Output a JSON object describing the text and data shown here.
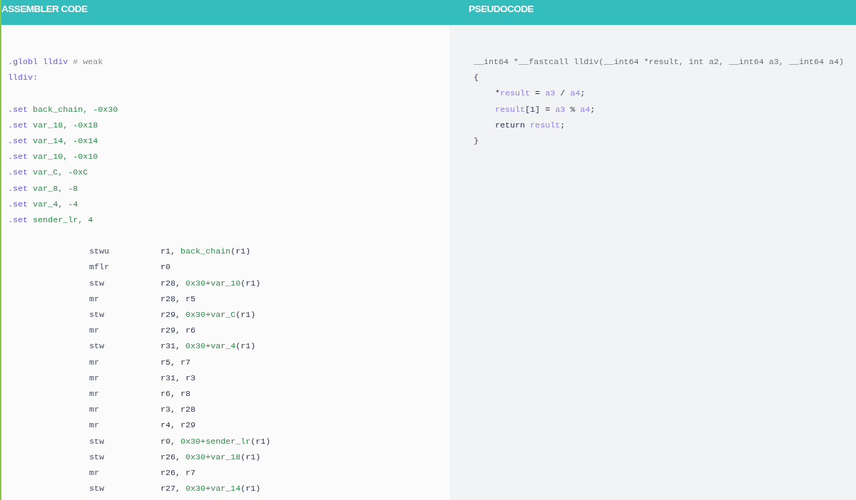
{
  "panels": [
    {
      "title": "ASSEMBLER CODE",
      "kind": "assembler",
      "lines": [
        {
          "kind": "directive",
          "tokens": [
            {
              "text": ".globl",
              "kind": "keyword"
            },
            {
              "text": " lldiv",
              "kind": "label"
            },
            {
              "text": " # weak",
              "kind": "comment"
            }
          ]
        },
        {
          "kind": "directive",
          "tokens": [
            {
              "text": "lldiv:",
              "kind": "label"
            }
          ]
        },
        {
          "kind": "blank"
        },
        {
          "kind": "directive",
          "tokens": [
            {
              "text": ".set",
              "kind": "keyword"
            },
            {
              "text": " back_chain, -0x30",
              "kind": "symbol"
            }
          ]
        },
        {
          "kind": "directive",
          "tokens": [
            {
              "text": ".set",
              "kind": "keyword"
            },
            {
              "text": " var_18, -0x18",
              "kind": "symbol"
            }
          ]
        },
        {
          "kind": "directive",
          "tokens": [
            {
              "text": ".set",
              "kind": "keyword"
            },
            {
              "text": " var_14, -0x14",
              "kind": "symbol"
            }
          ]
        },
        {
          "kind": "directive",
          "tokens": [
            {
              "text": ".set",
              "kind": "keyword"
            },
            {
              "text": " var_10, -0x10",
              "kind": "symbol"
            }
          ]
        },
        {
          "kind": "directive",
          "tokens": [
            {
              "text": ".set",
              "kind": "keyword"
            },
            {
              "text": " var_C, -0xC",
              "kind": "symbol"
            }
          ]
        },
        {
          "kind": "directive",
          "tokens": [
            {
              "text": ".set",
              "kind": "keyword"
            },
            {
              "text": " var_8, -8",
              "kind": "symbol"
            }
          ]
        },
        {
          "kind": "directive",
          "tokens": [
            {
              "text": ".set",
              "kind": "keyword"
            },
            {
              "text": " var_4, -4",
              "kind": "symbol"
            }
          ]
        },
        {
          "kind": "directive",
          "tokens": [
            {
              "text": ".set",
              "kind": "keyword"
            },
            {
              "text": " sender_lr, 4",
              "kind": "symbol"
            }
          ]
        },
        {
          "kind": "blank"
        },
        {
          "kind": "instruction",
          "mnemonic": "stwu",
          "tokens": [
            {
              "text": "r1, ",
              "kind": "plain"
            },
            {
              "text": "back_chain",
              "kind": "symbol"
            },
            {
              "text": "(r1)",
              "kind": "plain"
            }
          ]
        },
        {
          "kind": "instruction",
          "mnemonic": "mflr",
          "tokens": [
            {
              "text": "r0",
              "kind": "plain"
            }
          ]
        },
        {
          "kind": "instruction",
          "mnemonic": "stw",
          "tokens": [
            {
              "text": "r28, ",
              "kind": "plain"
            },
            {
              "text": "0x30+var_10",
              "kind": "symbol"
            },
            {
              "text": "(r1)",
              "kind": "plain"
            }
          ]
        },
        {
          "kind": "instruction",
          "mnemonic": "mr",
          "tokens": [
            {
              "text": "r28, r5",
              "kind": "plain"
            }
          ]
        },
        {
          "kind": "instruction",
          "mnemonic": "stw",
          "tokens": [
            {
              "text": "r29, ",
              "kind": "plain"
            },
            {
              "text": "0x30+var_C",
              "kind": "symbol"
            },
            {
              "text": "(r1)",
              "kind": "plain"
            }
          ]
        },
        {
          "kind": "instruction",
          "mnemonic": "mr",
          "tokens": [
            {
              "text": "r29, r6",
              "kind": "plain"
            }
          ]
        },
        {
          "kind": "instruction",
          "mnemonic": "stw",
          "tokens": [
            {
              "text": "r31, ",
              "kind": "plain"
            },
            {
              "text": "0x30+var_4",
              "kind": "symbol"
            },
            {
              "text": "(r1)",
              "kind": "plain"
            }
          ]
        },
        {
          "kind": "instruction",
          "mnemonic": "mr",
          "tokens": [
            {
              "text": "r5, r7",
              "kind": "plain"
            }
          ]
        },
        {
          "kind": "instruction",
          "mnemonic": "mr",
          "tokens": [
            {
              "text": "r31, r3",
              "kind": "plain"
            }
          ]
        },
        {
          "kind": "instruction",
          "mnemonic": "mr",
          "tokens": [
            {
              "text": "r6, r8",
              "kind": "plain"
            }
          ]
        },
        {
          "kind": "instruction",
          "mnemonic": "mr",
          "tokens": [
            {
              "text": "r3, r28",
              "kind": "plain"
            }
          ]
        },
        {
          "kind": "instruction",
          "mnemonic": "mr",
          "tokens": [
            {
              "text": "r4, r29",
              "kind": "plain"
            }
          ]
        },
        {
          "kind": "instruction",
          "mnemonic": "stw",
          "tokens": [
            {
              "text": "r0, ",
              "kind": "plain"
            },
            {
              "text": "0x30+sender_lr",
              "kind": "symbol"
            },
            {
              "text": "(r1)",
              "kind": "plain"
            }
          ]
        },
        {
          "kind": "instruction",
          "mnemonic": "stw",
          "tokens": [
            {
              "text": "r26, ",
              "kind": "plain"
            },
            {
              "text": "0x30+var_18",
              "kind": "symbol"
            },
            {
              "text": "(r1)",
              "kind": "plain"
            }
          ]
        },
        {
          "kind": "instruction",
          "mnemonic": "mr",
          "tokens": [
            {
              "text": "r26, r7",
              "kind": "plain"
            }
          ]
        },
        {
          "kind": "instruction",
          "mnemonic": "stw",
          "tokens": [
            {
              "text": "r27, ",
              "kind": "plain"
            },
            {
              "text": "0x30+var_14",
              "kind": "symbol"
            },
            {
              "text": "(r1)",
              "kind": "plain"
            }
          ]
        }
      ]
    },
    {
      "title": "PSEUDOCODE",
      "kind": "pseudocode",
      "lines": [
        {
          "kind": "code",
          "indented": false,
          "tokens": [
            {
              "text": "__int64 *__fastcall lldiv(__int64 *result, int a2, __int64 a3, __int64 a4)",
              "kind": "comment"
            }
          ]
        },
        {
          "kind": "code",
          "indented": false,
          "tokens": [
            {
              "text": "{",
              "kind": "brace"
            }
          ]
        },
        {
          "kind": "code",
          "indented": true,
          "tokens": [
            {
              "text": "*",
              "kind": "plain"
            },
            {
              "text": "result",
              "kind": "variable"
            },
            {
              "text": " = ",
              "kind": "plain"
            },
            {
              "text": "a3",
              "kind": "variable"
            },
            {
              "text": " / ",
              "kind": "plain"
            },
            {
              "text": "a4",
              "kind": "variable"
            },
            {
              "text": ";",
              "kind": "plain"
            }
          ]
        },
        {
          "kind": "code",
          "indented": true,
          "tokens": [
            {
              "text": "result",
              "kind": "variable"
            },
            {
              "text": "[1] = ",
              "kind": "plain"
            },
            {
              "text": "a3",
              "kind": "variable"
            },
            {
              "text": " % ",
              "kind": "plain"
            },
            {
              "text": "a4",
              "kind": "variable"
            },
            {
              "text": ";",
              "kind": "plain"
            }
          ]
        },
        {
          "kind": "code",
          "indented": true,
          "tokens": [
            {
              "text": "return ",
              "kind": "plain"
            },
            {
              "text": "result",
              "kind": "variable"
            },
            {
              "text": ";",
              "kind": "plain"
            }
          ]
        },
        {
          "kind": "code",
          "indented": false,
          "tokens": [
            {
              "text": "}",
              "kind": "brace"
            }
          ]
        }
      ]
    }
  ]
}
